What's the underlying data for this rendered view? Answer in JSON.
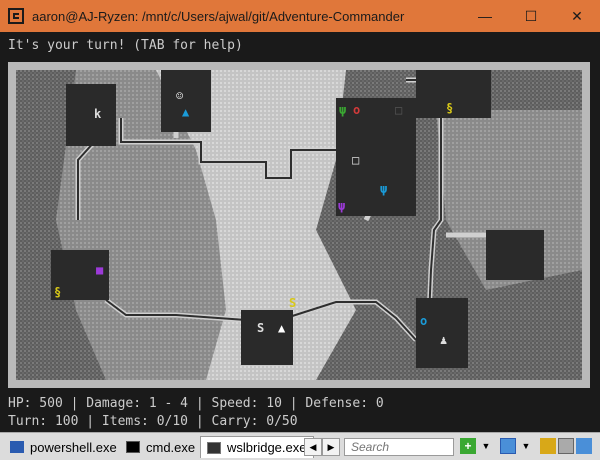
{
  "window": {
    "title": "aaron@AJ-Ryzen: /mnt/c/Users/ajwal/git/Adventure-Commander",
    "minimize": "—",
    "maximize": "☐",
    "close": "✕"
  },
  "game": {
    "message": "It's your turn! (TAB for help)",
    "stats_line1": "HP: 500 | Damage: 1 - 4 | Speed: 10 | Defense: 0",
    "stats_line2": "Turn: 100 | Items: 0/10 | Carry: 0/50",
    "map": {
      "symbols": {
        "player": "▲",
        "monster_k": "k",
        "snake": "S",
        "ring": "o",
        "helmet": "Δ"
      },
      "colors": {
        "rock_dark": "#6e6e6e",
        "rock_light": "#c8c8c8",
        "room_floor": "#2a2a2a",
        "corridor": "#4a4a4a",
        "frame": "#b9b9b9",
        "item_green": "#3aa832",
        "item_red": "#d23a3a",
        "item_cyan": "#1a9bd8",
        "item_yellow": "#d8c818",
        "item_purple": "#9c3ad8",
        "item_white": "#dddddd"
      }
    }
  },
  "taskbar": {
    "tabs": [
      {
        "label": "powershell.exe",
        "icon": "powershell-icon"
      },
      {
        "label": "cmd.exe",
        "icon": "cmd-icon"
      },
      {
        "label": "wslbridge.exe",
        "icon": "terminal-icon"
      }
    ],
    "search_placeholder": "Search",
    "nav_prev": "◀",
    "nav_next": "▶"
  }
}
